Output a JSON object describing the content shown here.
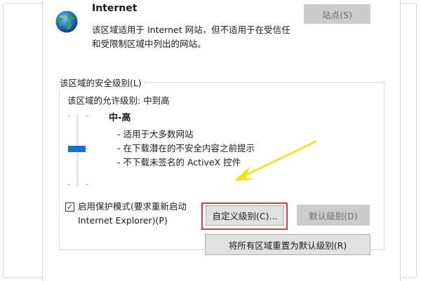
{
  "zone": {
    "icon": "globe-icon",
    "title": "Internet",
    "description_lines": [
      "该区域适用于 Internet 网站，但不适用于在受信任",
      "和受限制区域中列出的网站。"
    ],
    "sites_button": "站点(S)"
  },
  "security": {
    "group_label": "该区域的安全级别(L)",
    "allowed_levels": "该区域的允许级别: 中到高",
    "level_name": "中-高",
    "level_description": [
      "- 适用于大多数网站",
      "- 在下载潜在的不安全内容之前提示",
      "- 不下载未签名的 ActiveX 控件"
    ],
    "slider_level": "中-高"
  },
  "protected_mode": {
    "checked": true,
    "check_glyph": "✓",
    "label_lines": [
      "启用保护模式(要求重新启动",
      "Internet Explorer)(P)"
    ]
  },
  "buttons": {
    "custom_level": "自定义级别(C)...",
    "default_level": "默认级别(D)",
    "reset_all": "将所有区域重置为默认级别(R)"
  },
  "colors": {
    "highlight": "#e03b3b",
    "arrow": "#f2e400",
    "slider_thumb": "#1272d3"
  }
}
